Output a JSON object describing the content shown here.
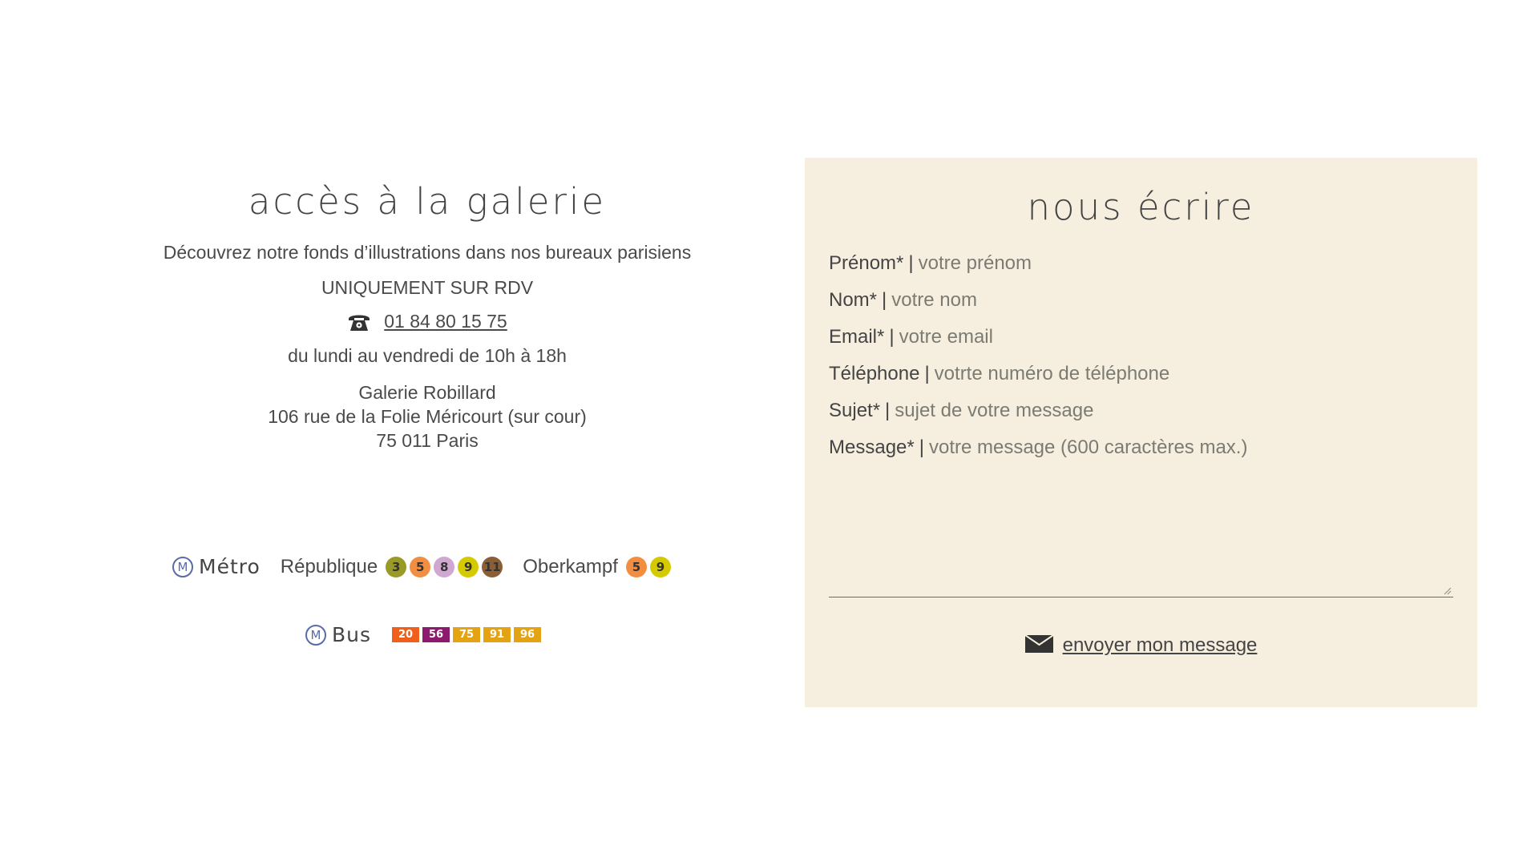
{
  "access": {
    "title": "accès à la galerie",
    "intro": "Découvrez notre fonds d’illustrations dans nos bureaux parisiens",
    "appointment": "UNIQUEMENT SUR RDV",
    "phone": "01 84 80 15 75",
    "hours": "du lundi au vendredi de 10h à 18h",
    "address": {
      "name": "Galerie Robillard",
      "street": "106 rue de la Folie Méricourt (sur cour)",
      "city": "75 011 Paris"
    }
  },
  "transport": {
    "metro_logo": "M",
    "metro_label": "Métro",
    "stations": [
      {
        "name": "République",
        "lines": [
          {
            "num": "3",
            "color": "#9a9a26"
          },
          {
            "num": "5",
            "color": "#f28e42"
          },
          {
            "num": "8",
            "color": "#cfa7d0"
          },
          {
            "num": "9",
            "color": "#d5c900"
          },
          {
            "num": "11",
            "color": "#8b5e34"
          }
        ]
      },
      {
        "name": "Oberkampf",
        "lines": [
          {
            "num": "5",
            "color": "#f28e42"
          },
          {
            "num": "9",
            "color": "#d5c900"
          }
        ]
      }
    ],
    "bus_logo": "M",
    "bus_label": "Bus",
    "bus_lines": [
      {
        "num": "20",
        "color": "#f0601a"
      },
      {
        "num": "56",
        "color": "#8e1a6e"
      },
      {
        "num": "75",
        "color": "#e3a312"
      },
      {
        "num": "91",
        "color": "#e3a312"
      },
      {
        "num": "96",
        "color": "#e3a312"
      }
    ]
  },
  "contact": {
    "title": "nous écrire",
    "fields": {
      "firstname": {
        "label": "Prénom*",
        "placeholder": "votre prénom"
      },
      "lastname": {
        "label": "Nom*",
        "placeholder": "votre nom"
      },
      "email": {
        "label": "Email*",
        "placeholder": "votre email"
      },
      "phone": {
        "label": "Téléphone",
        "placeholder": "votrte numéro de téléphone"
      },
      "subject": {
        "label": "Sujet*",
        "placeholder": "sujet de votre message"
      },
      "message": {
        "label": "Message*",
        "placeholder": "votre message (600 caractères max.)"
      }
    },
    "separator": "|",
    "send_label": "envoyer mon message"
  },
  "colors": {
    "form_background": "#f6efdf",
    "text": "#4a4a4a",
    "metro_blue": "#5a6ba8"
  },
  "icons": {
    "phone": "phone-icon",
    "envelope": "envelope-icon",
    "metro": "metro-logo-icon"
  }
}
